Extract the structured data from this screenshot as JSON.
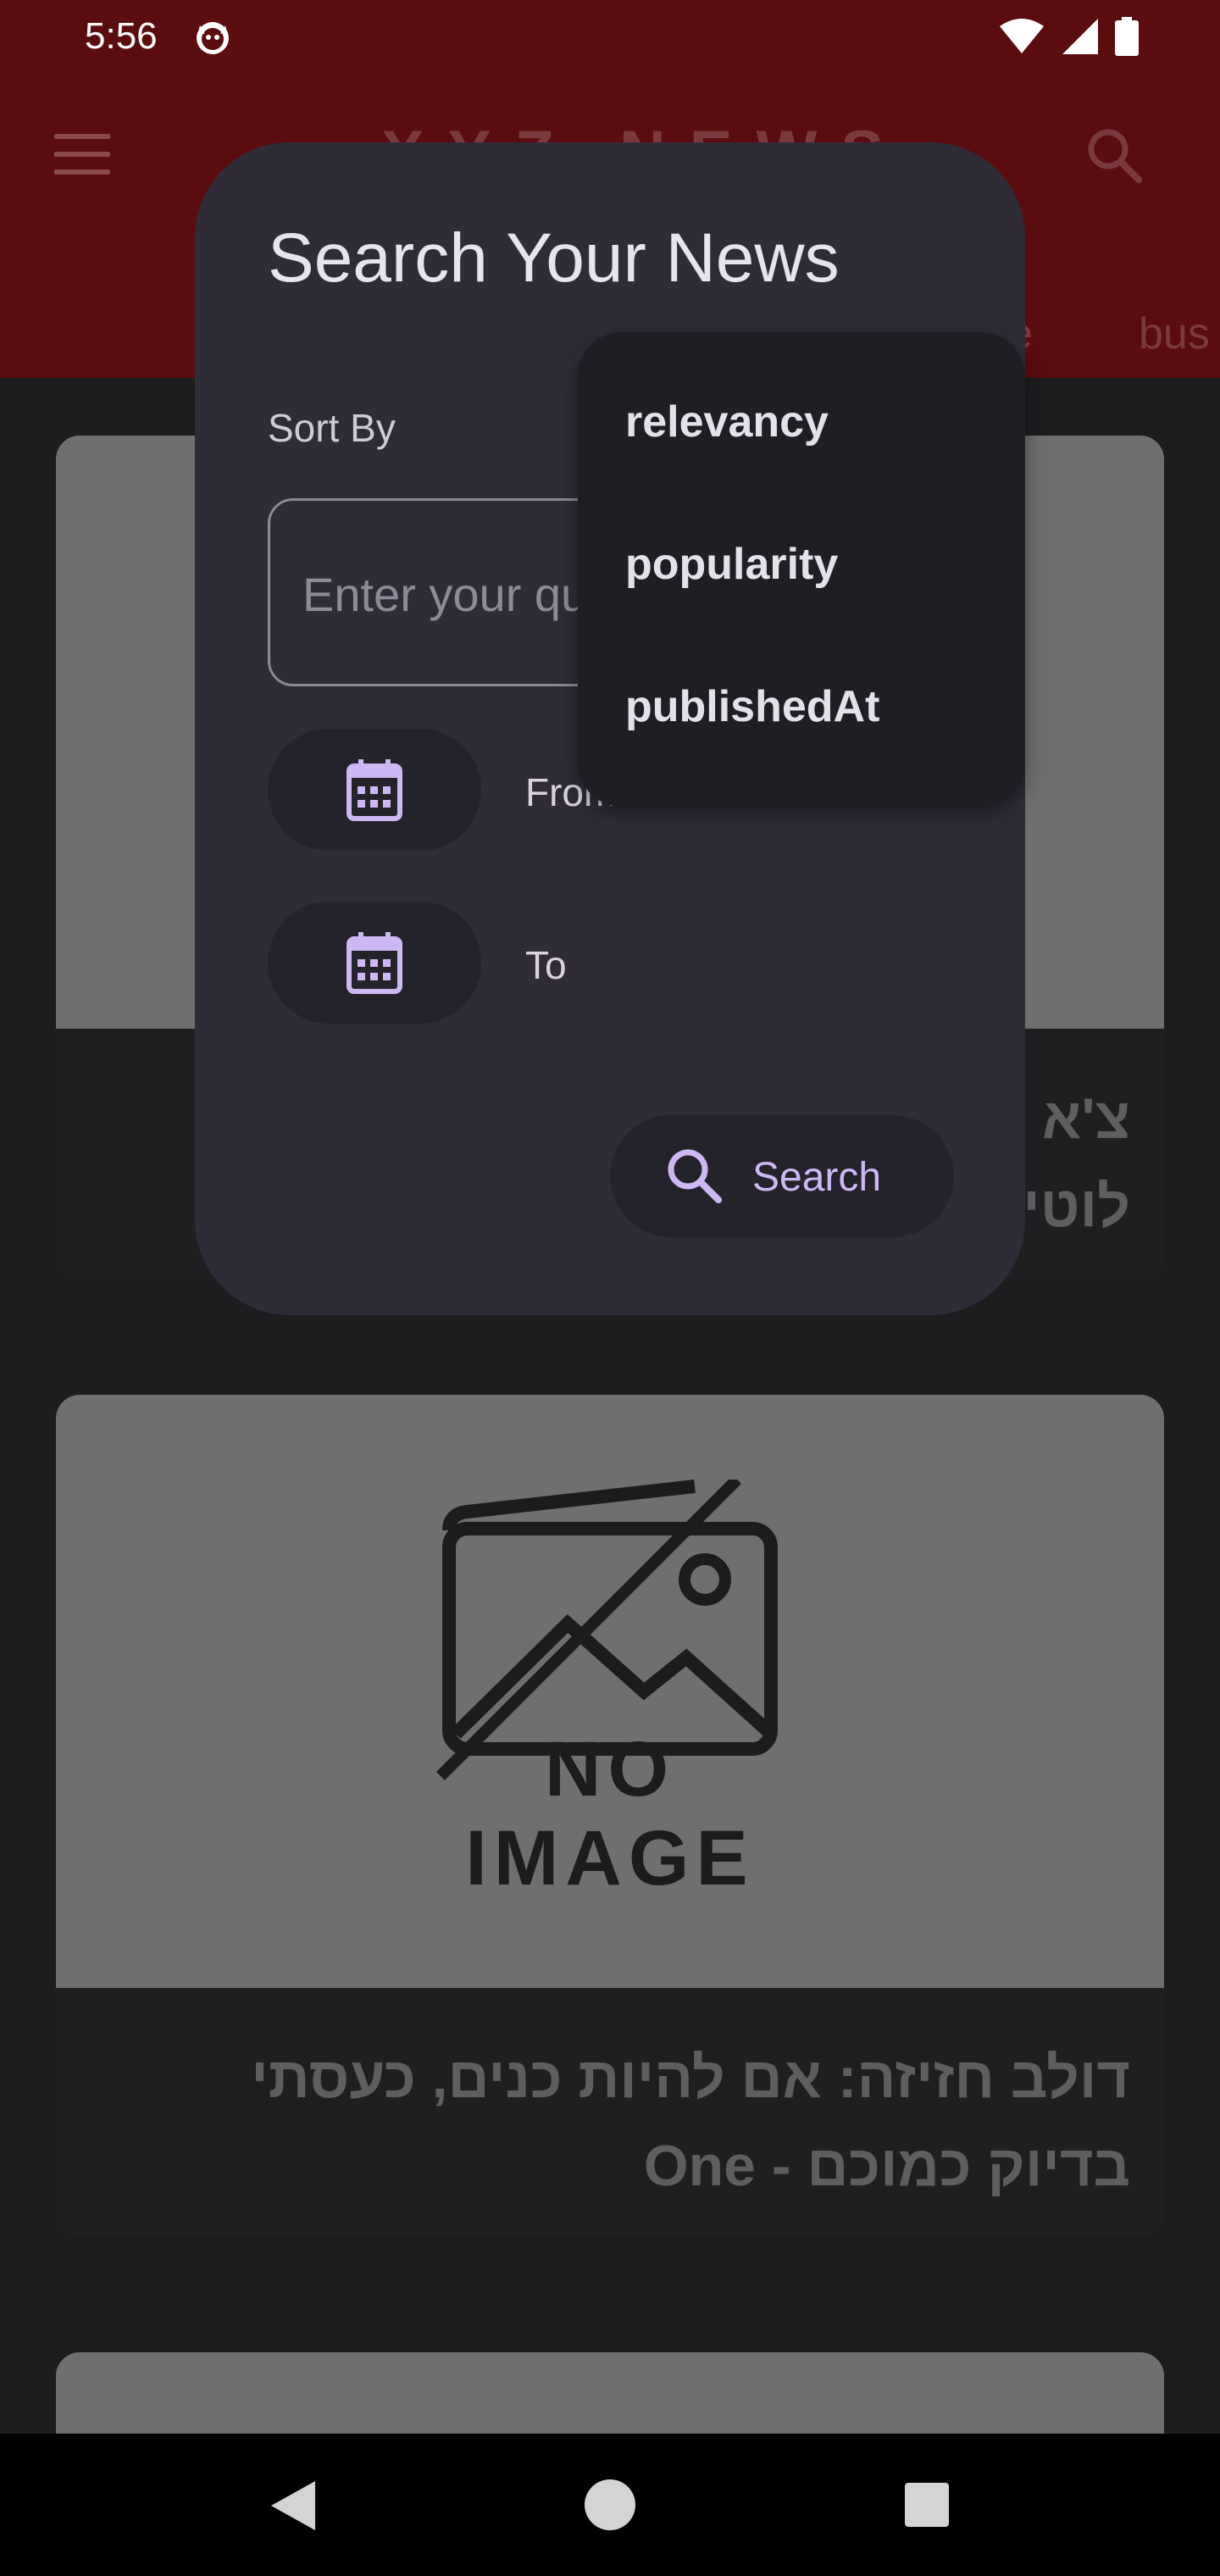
{
  "status_bar": {
    "time": "5:56"
  },
  "app_bar": {
    "title": "XYZ NEWS",
    "tabs": [
      "e",
      "bus"
    ]
  },
  "feed": {
    "cards": [
      {
        "title_line1": "צ'א                                          עליי",
        "title_line2": "לוטין"
      },
      {
        "image_label": "NO IMAGE",
        "title_line1": "דולב חזיזה: אם להיות כנים, כעסתי",
        "title_line2": "בדיוק כמוכם - One"
      }
    ]
  },
  "dialog": {
    "title": "Search Your News",
    "sort_label": "Sort By",
    "query_placeholder": "Enter your query",
    "from_label": "From",
    "to_label": "To",
    "search_label": "Search"
  },
  "sort_menu": {
    "options": [
      "relevancy",
      "popularity",
      "publishedAt"
    ]
  },
  "colors": {
    "app_bar": "#5a0c0f",
    "dialog_bg": "#2f2c38",
    "accent": "#cdb8f4",
    "menu_bg": "#1f1e24"
  }
}
